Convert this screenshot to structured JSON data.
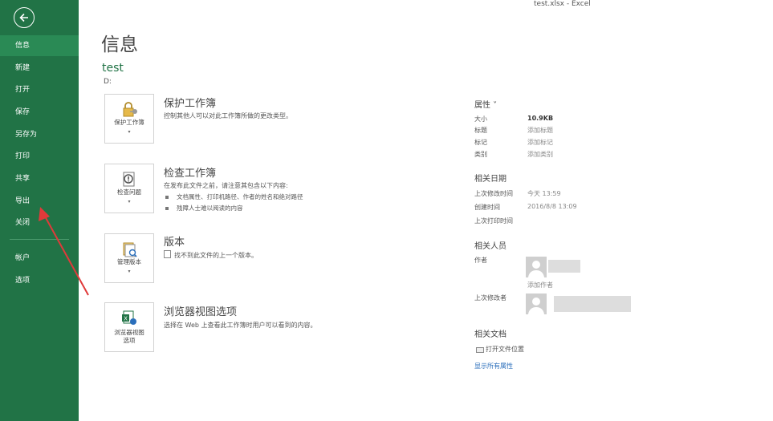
{
  "window": {
    "title": "test.xlsx - Excel"
  },
  "sidebar": {
    "items": [
      {
        "label": "信息"
      },
      {
        "label": "新建"
      },
      {
        "label": "打开"
      },
      {
        "label": "保存"
      },
      {
        "label": "另存为"
      },
      {
        "label": "打印"
      },
      {
        "label": "共享"
      },
      {
        "label": "导出"
      },
      {
        "label": "关闭"
      },
      {
        "label": "帐户"
      },
      {
        "label": "选项"
      }
    ]
  },
  "main": {
    "title": "信息",
    "doc_name": "test",
    "doc_path": "D:",
    "sections": [
      {
        "button": "保护工作簿",
        "title": "保护工作簿",
        "desc": "控制其他人可以对此工作簿所做的更改类型。"
      },
      {
        "button": "检查问题",
        "title": "检查工作簿",
        "desc": "在发布此文件之前，请注意其包含以下内容:",
        "bullets": [
          "文档属性、打印机路径、作者的姓名和绝对路径",
          "残障人士难以阅读的内容"
        ]
      },
      {
        "button": "管理版本",
        "title": "版本",
        "desc": "找不到此文件的上一个版本。"
      },
      {
        "button_line1": "浏览器视图",
        "button_line2": "选项",
        "title": "浏览器视图选项",
        "desc": "选择在 Web 上查看此工作簿时用户可以看到的内容。"
      }
    ]
  },
  "properties": {
    "header": "属性 ˅",
    "rows": [
      {
        "label": "大小",
        "value": "10.9KB"
      },
      {
        "label": "标题",
        "value": "添加标题"
      },
      {
        "label": "标记",
        "value": "添加标记"
      },
      {
        "label": "类别",
        "value": "添加类别"
      }
    ],
    "dates_header": "相关日期",
    "dates": [
      {
        "label": "上次修改时间",
        "value": "今天 13:59"
      },
      {
        "label": "创建时间",
        "value": "2016/8/8 13:09"
      },
      {
        "label": "上次打印时间",
        "value": ""
      }
    ],
    "people_header": "相关人员",
    "author_label": "作者",
    "add_author": "添加作者",
    "modifier_label": "上次修改者",
    "docs_header": "相关文档",
    "open_location": "打开文件位置",
    "show_all": "显示所有属性"
  },
  "colors": {
    "accent": "#217346",
    "link": "#2a6ebb",
    "annotation": "#e03a3a"
  }
}
